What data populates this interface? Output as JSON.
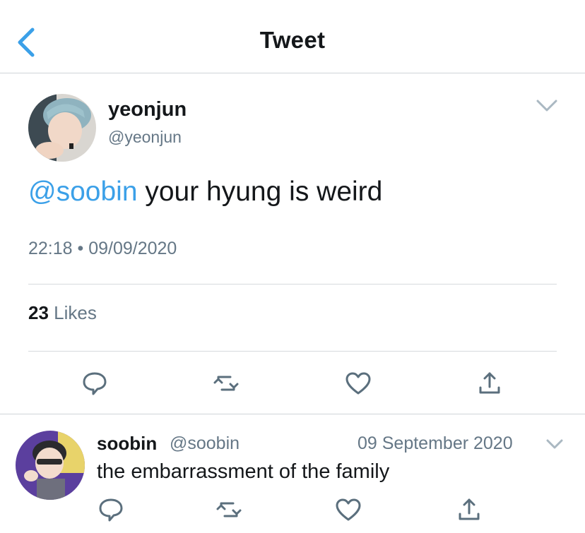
{
  "header": {
    "title": "Tweet",
    "back_icon": "chevron-left-icon"
  },
  "colors": {
    "accent": "#3ba0e8",
    "secondary_text": "#657786",
    "divider": "#d6dadd"
  },
  "main_tweet": {
    "name": "yeonjun",
    "handle": "@yeonjun",
    "mention": "@soobin",
    "text": " your hyung is weird",
    "time": "22:18 • 09/09/2020",
    "likes_count": "23",
    "likes_label": " Likes",
    "actions": [
      "reply-icon",
      "retweet-icon",
      "like-icon",
      "share-icon"
    ]
  },
  "reply_tweet": {
    "name": "soobin",
    "handle": "@soobin",
    "date": "09 September 2020",
    "text": "the embarrassment of the family",
    "actions": [
      "reply-icon",
      "retweet-icon",
      "like-icon",
      "share-icon"
    ]
  }
}
